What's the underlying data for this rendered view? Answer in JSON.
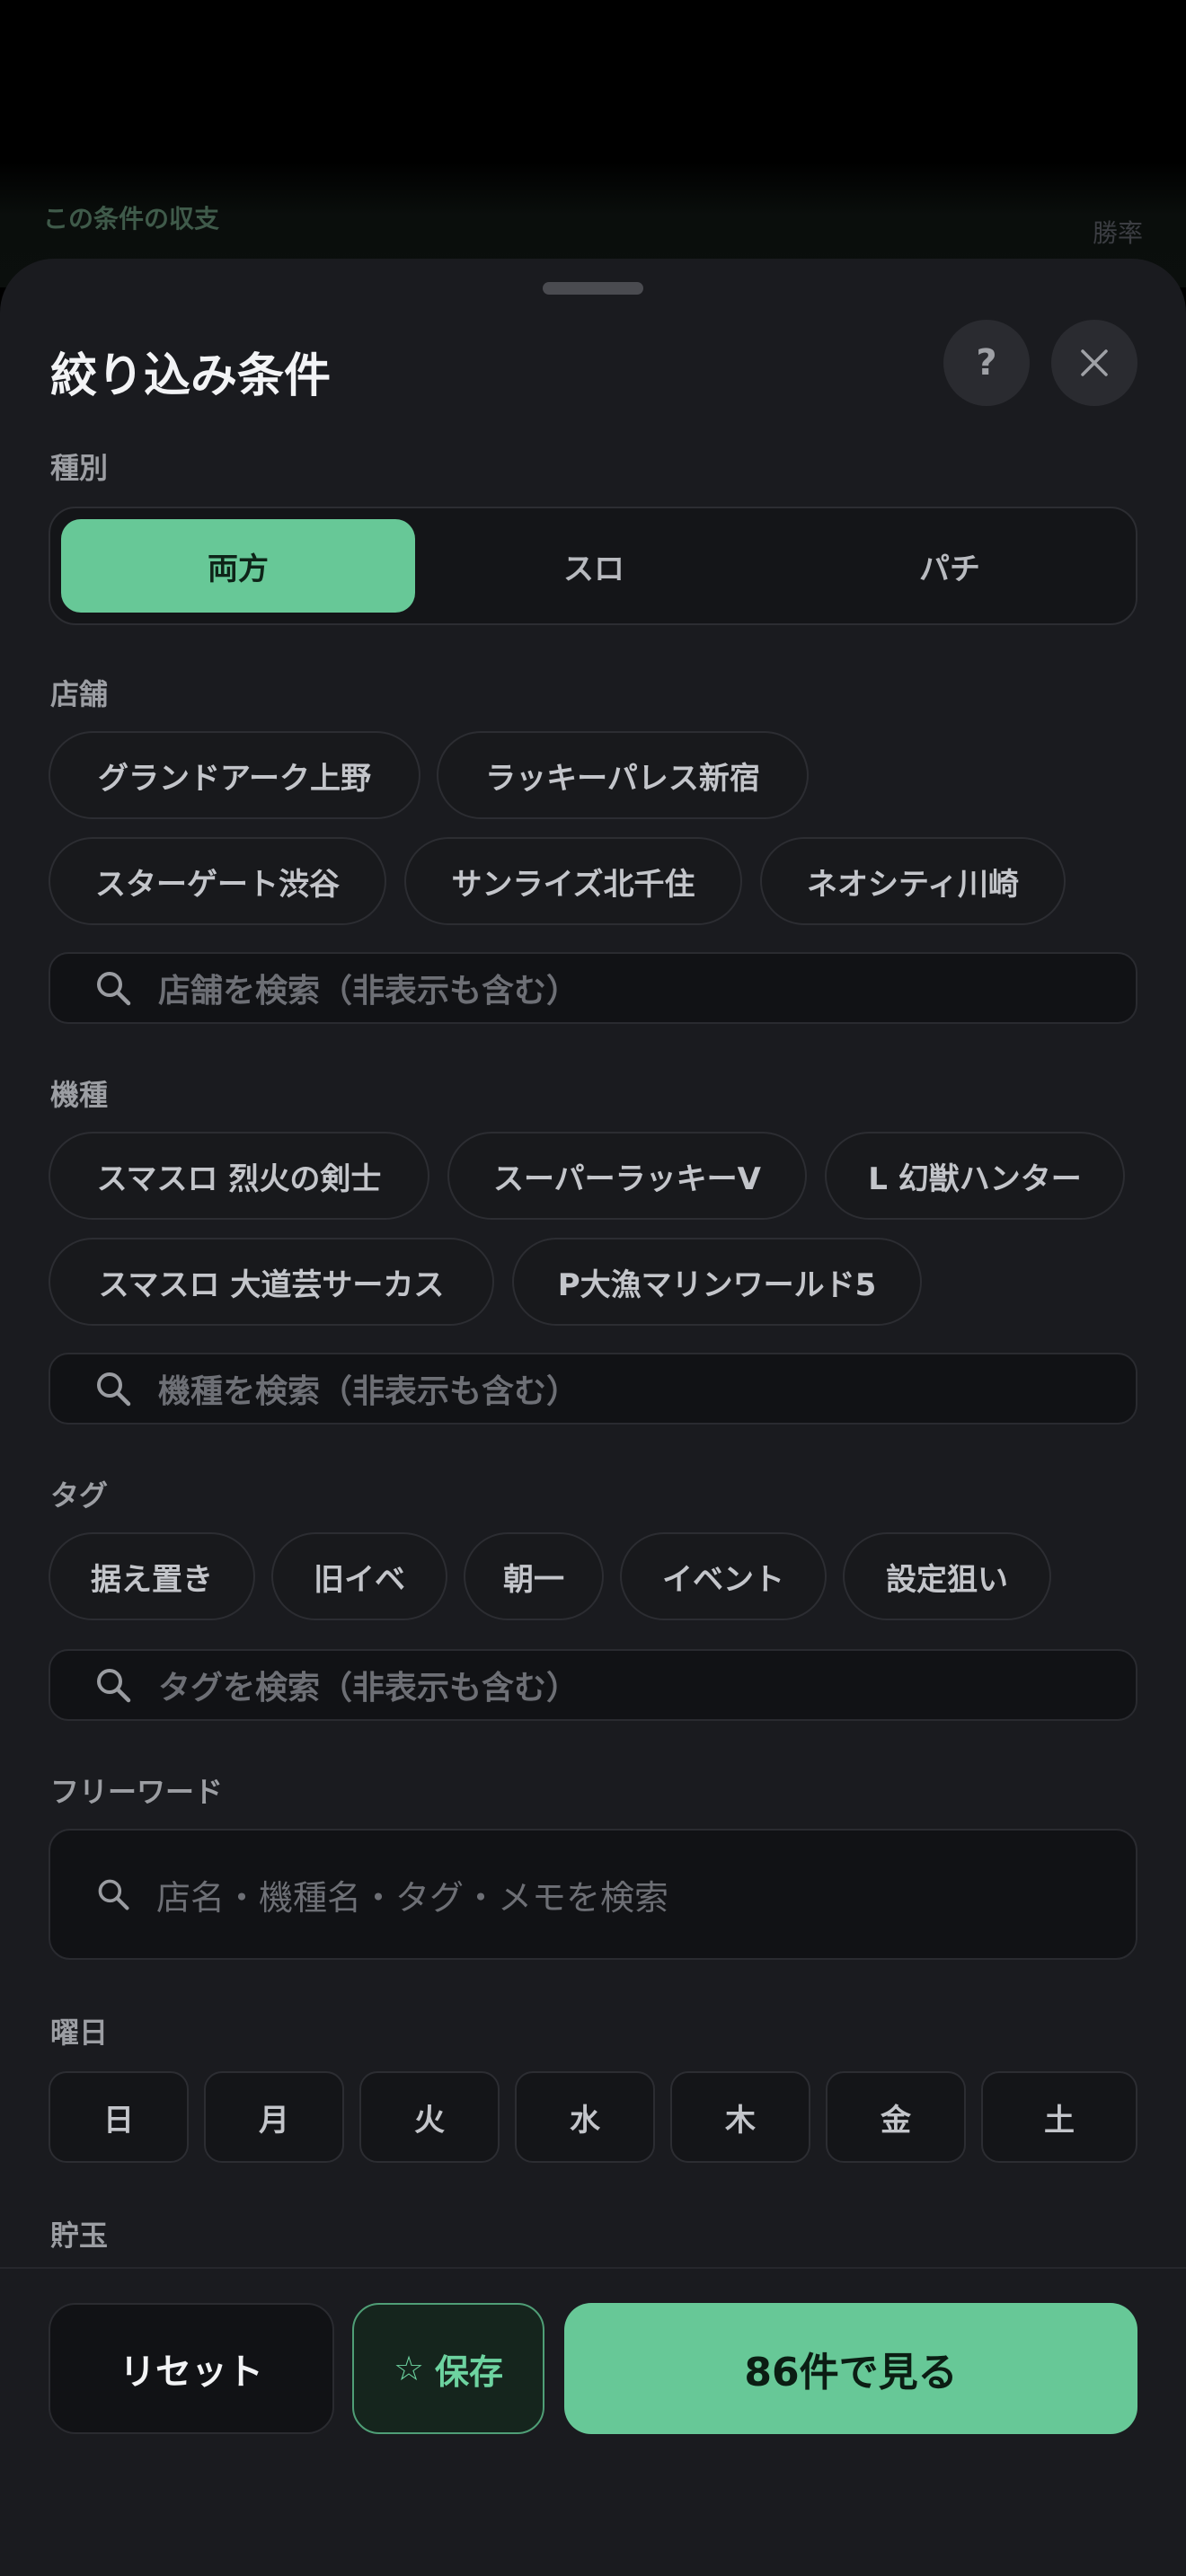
{
  "background": {
    "label": "この条件の収支",
    "win_label": "勝率"
  },
  "sheet": {
    "title": "絞り込み条件",
    "help_icon": "question-icon",
    "close_icon": "close-icon",
    "help_label": "?",
    "close_label": "✕"
  },
  "type": {
    "label": "種別",
    "options": [
      "両方",
      "スロ",
      "パチ"
    ],
    "selected": "両方"
  },
  "stores": {
    "label": "店舗",
    "items": [
      "グランドアーク上野",
      "ラッキーパレス新宿",
      "スターゲート渋谷",
      "サンライズ北千住",
      "ネオシティ川崎"
    ],
    "search_placeholder": "店舗を検索（非表示も含む）"
  },
  "machines": {
    "label": "機種",
    "items": [
      "スマスロ 烈火の剣士",
      "スーパーラッキーV",
      "L 幻獣ハンター",
      "スマスロ 大道芸サーカス",
      "P大漁マリンワールド5"
    ],
    "search_placeholder": "機種を検索（非表示も含む）"
  },
  "tags": {
    "label": "タグ",
    "items": [
      "据え置き",
      "旧イベ",
      "朝一",
      "イベント",
      "設定狙い"
    ],
    "search_placeholder": "タグを検索（非表示も含む）"
  },
  "freeword": {
    "label": "フリーワード",
    "placeholder": "店名・機種名・タグ・メモを検索"
  },
  "weekday": {
    "label": "曜日",
    "days": [
      "日",
      "月",
      "火",
      "水",
      "木",
      "金",
      "土"
    ]
  },
  "savings": {
    "label": "貯玉"
  },
  "footer": {
    "reset_label": "リセット",
    "save_label": "保存",
    "save_icon": "☆",
    "view_label": "86件で見る"
  },
  "colors": {
    "accent": "#67c897",
    "sheet_bg": "#1a1b1f",
    "chip_bg": "#18191c"
  }
}
